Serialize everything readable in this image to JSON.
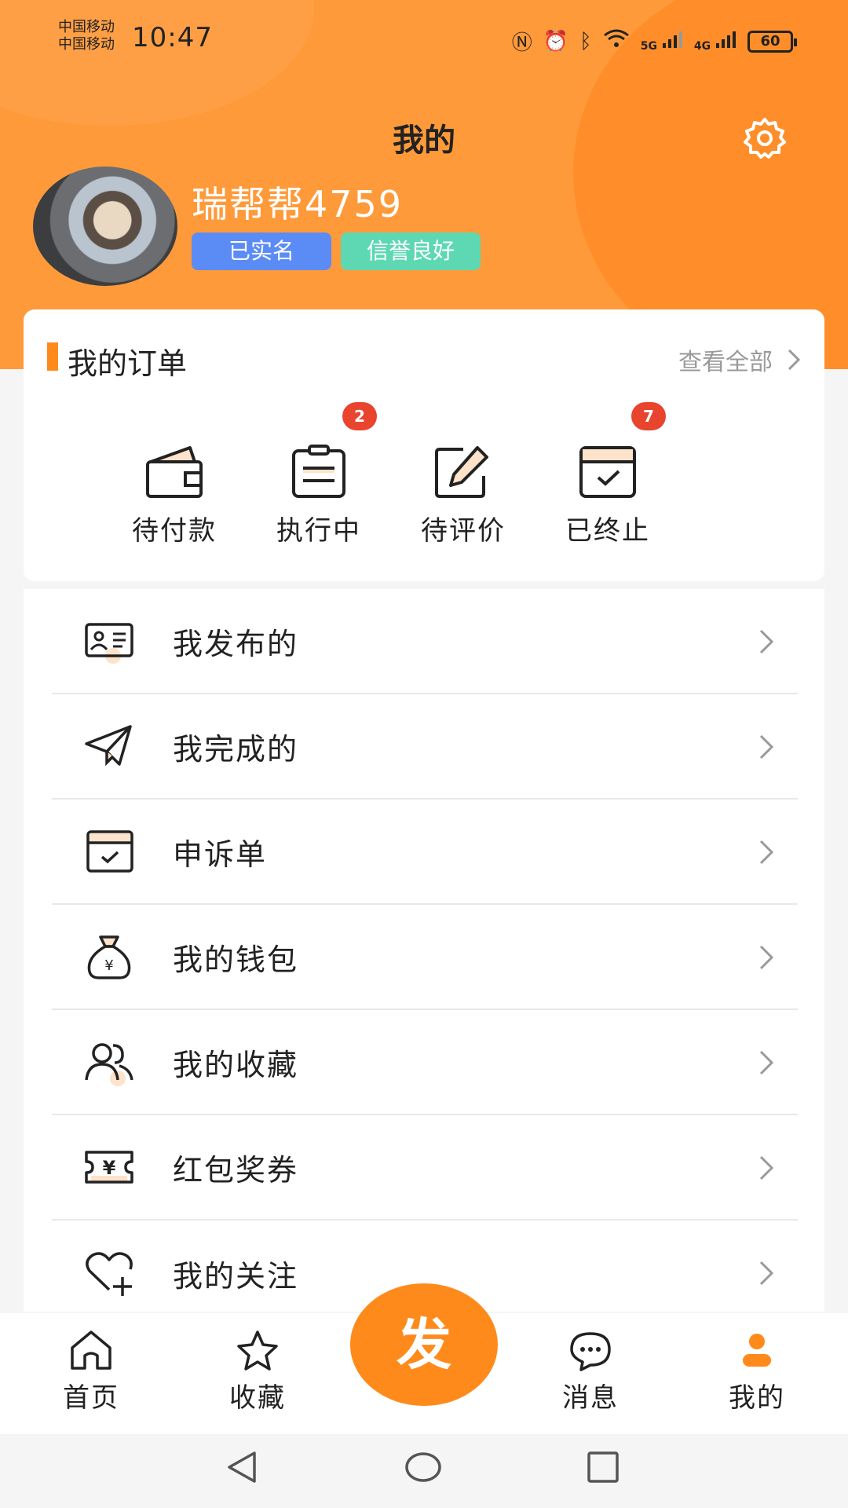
{
  "status_bar": {
    "carrier1": "中国移动",
    "carrier2": "中国移动",
    "time": "10:47",
    "battery": "60",
    "net1": "5G",
    "net2": "4G"
  },
  "header": {
    "title": "我的",
    "settings_icon": "gear-icon"
  },
  "profile": {
    "username": "瑞帮帮4759",
    "badge_verified": "已实名",
    "badge_credit": "信誉良好"
  },
  "orders": {
    "title": "我的订单",
    "view_all": "查看全部",
    "items": [
      {
        "label": "待付款",
        "icon": "wallet-icon",
        "badge": ""
      },
      {
        "label": "执行中",
        "icon": "clipboard-icon",
        "badge": "2"
      },
      {
        "label": "待评价",
        "icon": "edit-icon",
        "badge": ""
      },
      {
        "label": "已终止",
        "icon": "calendar-check-icon",
        "badge": "7"
      }
    ]
  },
  "menu": [
    {
      "label": "我发布的",
      "icon": "id-card-icon"
    },
    {
      "label": "我完成的",
      "icon": "paper-plane-icon"
    },
    {
      "label": "申诉单",
      "icon": "calendar-check-icon"
    },
    {
      "label": "我的钱包",
      "icon": "money-bag-icon"
    },
    {
      "label": "我的收藏",
      "icon": "users-icon"
    },
    {
      "label": "红包奖券",
      "icon": "coupon-icon"
    },
    {
      "label": "我的关注",
      "icon": "heart-plus-icon"
    }
  ],
  "bottom_nav": {
    "home": "首页",
    "favorites": "收藏",
    "publish": "发",
    "messages": "消息",
    "mine": "我的"
  },
  "colors": {
    "accent": "#ff8a1c",
    "header": "#ff9a3a",
    "badge_blue": "#5b8cf5",
    "badge_green": "#5ed8b3",
    "badge_red": "#e8442e"
  }
}
